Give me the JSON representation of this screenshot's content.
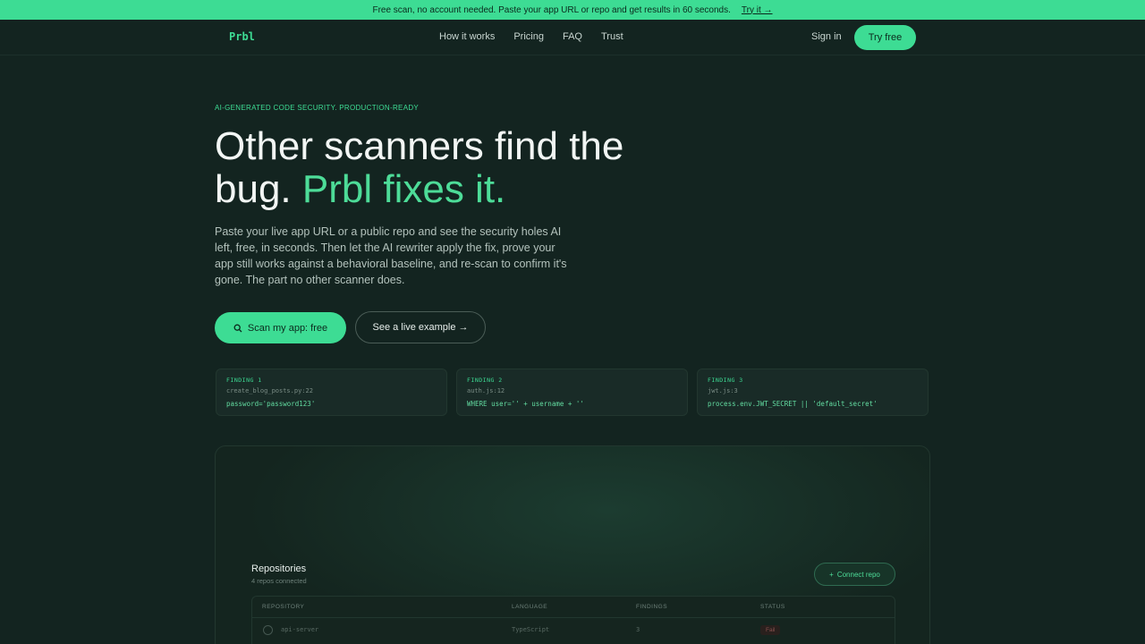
{
  "banner": {
    "text": "Free scan, no account needed. Paste your app URL or repo and get results in 60 seconds.",
    "link": "Try it →"
  },
  "nav": {
    "logo": "Prbl",
    "links": [
      "How it works",
      "Pricing",
      "FAQ",
      "Trust"
    ],
    "sign_in": "Sign in",
    "cta": "Try free"
  },
  "hero": {
    "eyebrow": "AI-GENERATED CODE SECURITY. PRODUCTION-READY",
    "headline_main": "Other scanners find the bug.",
    "headline_accent": "Prbl fixes it.",
    "lede": "Paste your live app URL or a public repo and see the security holes AI left, free, in seconds. Then let the AI rewriter apply the fix, prove your app still works against a behavioral baseline, and re-scan to confirm it's gone. The part no other scanner does.",
    "primary_button": "Scan my app: free",
    "secondary_button": "See a live example →"
  },
  "findings": [
    {
      "label": "FINDING 1",
      "file": "create_blog_posts.py:22",
      "code": "password='password123'"
    },
    {
      "label": "FINDING 2",
      "file": "auth.js:12",
      "code": "WHERE user='' + username + ''"
    },
    {
      "label": "FINDING 3",
      "file": "jwt.js:3",
      "code": "process.env.JWT_SECRET || 'default_secret'"
    }
  ],
  "repos": {
    "title": "Repositories",
    "subtitle": "4 repos connected",
    "connect_button": "Connect repo",
    "columns": [
      "REPOSITORY",
      "LANGUAGE",
      "FINDINGS",
      "STATUS"
    ],
    "rows": [
      {
        "name": "api-server",
        "language": "TypeScript",
        "findings": "3",
        "status": "Fail"
      }
    ]
  },
  "colors": {
    "accent": "#3ddc94",
    "background": "#132420"
  }
}
